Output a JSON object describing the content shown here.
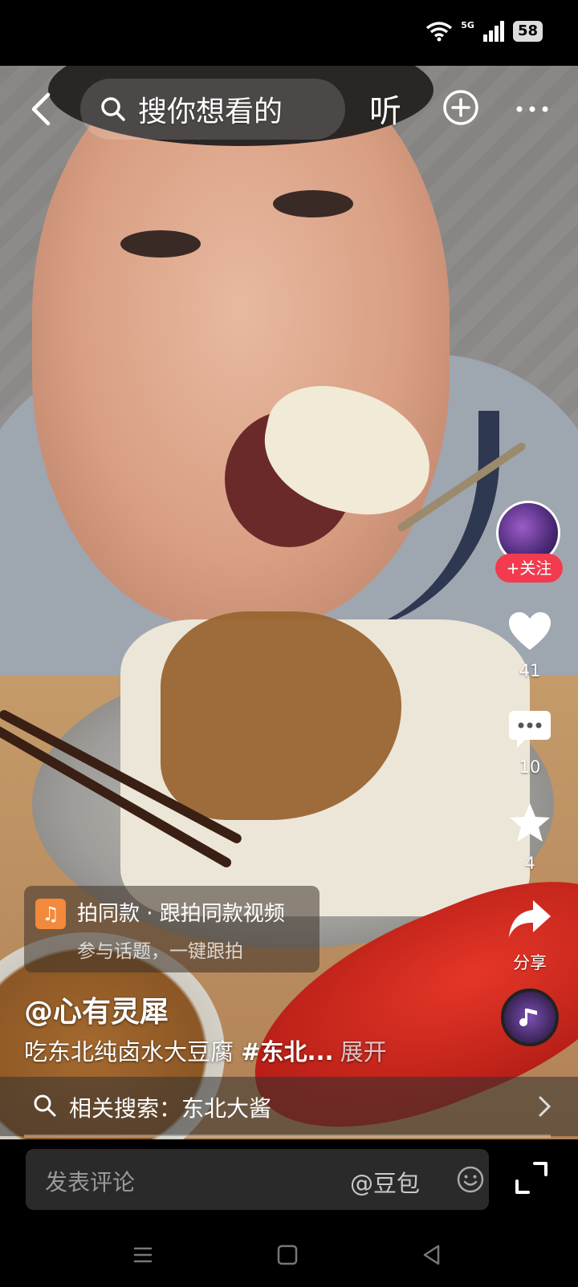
{
  "status_bar": {
    "network": "5G",
    "battery": "58"
  },
  "top_bar": {
    "search_placeholder": "搜你想看的",
    "listen_label": "听"
  },
  "side_rail": {
    "follow_label": "+关注",
    "likes": "41",
    "comments": "10",
    "favorites": "4",
    "share_label": "分享"
  },
  "template_card": {
    "title": "拍同款 · 跟拍同款视频",
    "subtitle": "参与话题，一键跟拍"
  },
  "post": {
    "author": "@心有灵犀",
    "caption": "吃东北纯卤水大豆腐 ",
    "hashtag": "#东北...",
    "expand_label": "展开"
  },
  "related_search": {
    "label": "相关搜索：东北大酱"
  },
  "comment_bar": {
    "placeholder": "发表评论",
    "mention": "@豆包"
  },
  "colors": {
    "follow_red": "#f23b4e",
    "template_orange": "#f3893a"
  },
  "icons": [
    "back-icon",
    "search-icon",
    "add-icon",
    "more-icon",
    "heart-icon",
    "comment-icon",
    "star-icon",
    "share-icon",
    "music-icon",
    "emoji-icon",
    "fullscreen-icon",
    "chevron-right-icon"
  ]
}
